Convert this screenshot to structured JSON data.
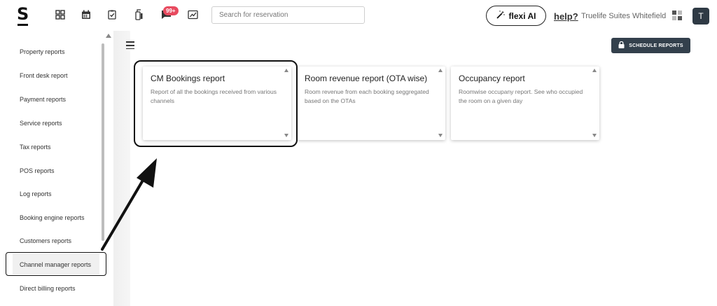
{
  "header": {
    "logo": "S",
    "notification_badge": "99+",
    "search_placeholder": "Search for reservation",
    "flexi_label": "flexi AI",
    "help_label": "help?",
    "property_name": "Truelife Suites Whitefield",
    "avatar_initial": "T",
    "icons": [
      "dashboard-icon",
      "calendar-icon",
      "checklist-icon",
      "housekeeping-icon",
      "notification-icon",
      "reports-icon"
    ]
  },
  "sidebar": {
    "items": [
      {
        "label": "Property reports"
      },
      {
        "label": "Front desk report"
      },
      {
        "label": "Payment reports"
      },
      {
        "label": "Service reports"
      },
      {
        "label": "Tax reports"
      },
      {
        "label": "POS reports"
      },
      {
        "label": "Log reports"
      },
      {
        "label": "Booking engine reports"
      },
      {
        "label": "Customers reports"
      },
      {
        "label": "Channel manager reports"
      },
      {
        "label": "Direct billing reports"
      }
    ],
    "selected": "Channel manager reports"
  },
  "main": {
    "schedule_label": "SCHEDULE REPORTS",
    "cards": [
      {
        "title": "CM Bookings report",
        "desc": "Report of all the bookings received from various channels"
      },
      {
        "title": "Room revenue report (OTA wise)",
        "desc": "Room revenue from each booking seggregated based on the OTAs"
      },
      {
        "title": "Occupancy report",
        "desc": "Roomwise occupany report. See who occupied the room on a given day"
      }
    ]
  },
  "colors": {
    "badge": "#e84a5f",
    "dark_button": "#33404c",
    "avatar": "#2f3a45"
  }
}
